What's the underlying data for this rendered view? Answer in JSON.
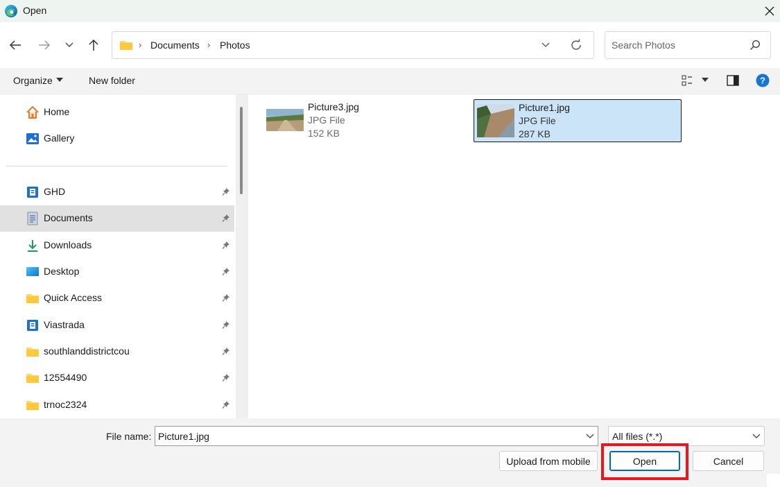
{
  "window": {
    "title": "Open",
    "close_icon": "close-icon"
  },
  "navigation": {
    "breadcrumb": [
      "Documents",
      "Photos"
    ],
    "search_placeholder": "Search Photos"
  },
  "toolbar": {
    "organize_label": "Organize",
    "new_folder_label": "New folder"
  },
  "sidebar": {
    "items": [
      {
        "label": "Home",
        "icon": "home-icon",
        "pinned": false
      },
      {
        "label": "Gallery",
        "icon": "gallery-icon",
        "pinned": false
      },
      {
        "label": "GHD",
        "icon": "sharepoint-icon",
        "pinned": true
      },
      {
        "label": "Documents",
        "icon": "documents-icon",
        "pinned": true,
        "selected": true
      },
      {
        "label": "Downloads",
        "icon": "downloads-icon",
        "pinned": true
      },
      {
        "label": "Desktop",
        "icon": "desktop-icon",
        "pinned": true
      },
      {
        "label": "Quick Access",
        "icon": "folder-icon",
        "pinned": true
      },
      {
        "label": "Viastrada",
        "icon": "sharepoint-icon",
        "pinned": true
      },
      {
        "label": "southlanddistrictcou",
        "icon": "folder-icon",
        "pinned": true
      },
      {
        "label": "12554490",
        "icon": "folder-icon",
        "pinned": true
      },
      {
        "label": "trnoc2324",
        "icon": "folder-icon",
        "pinned": true
      }
    ]
  },
  "files": [
    {
      "name": "Picture3.jpg",
      "type": "JPG File",
      "size": "152 KB",
      "selected": false
    },
    {
      "name": "Picture1.jpg",
      "type": "JPG File",
      "size": "287 KB",
      "selected": true
    }
  ],
  "footer": {
    "file_name_label": "File name:",
    "file_name_value": "Picture1.jpg",
    "file_type_filter": "All files (*.*)",
    "upload_label": "Upload from mobile",
    "open_label": "Open",
    "cancel_label": "Cancel"
  },
  "colors": {
    "accent": "#0067c0",
    "selection": "#cce4f7",
    "highlight_box": "#e8161d"
  }
}
